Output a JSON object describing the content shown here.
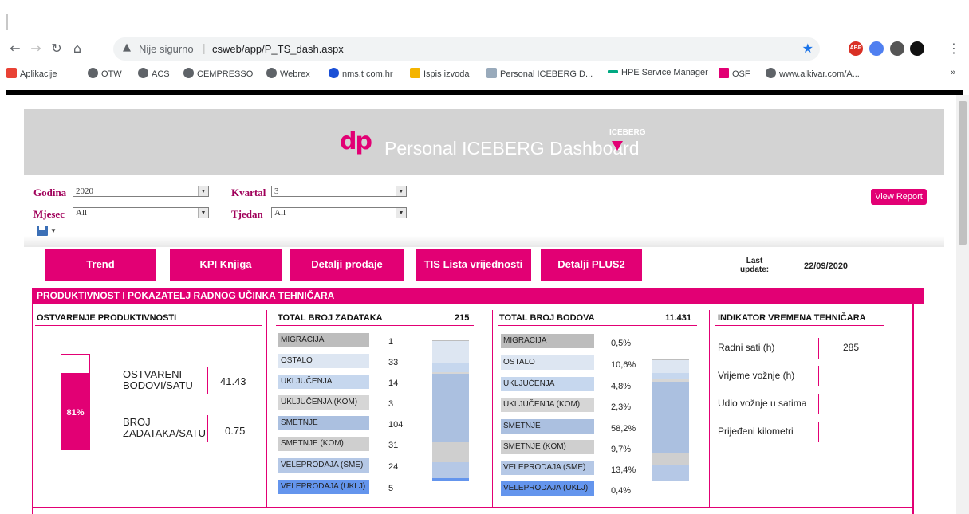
{
  "browser": {
    "url_warning": "Nije sigurno",
    "url_host": "csweb/app/P_TS_dash.aspx",
    "bookmarks": [
      "Aplikacije",
      "OTW",
      "ACS",
      "CEMPRESSO",
      "Webrex",
      "nms.t com.hr",
      "Ispis izvoda",
      "Personal ICEBERG D...",
      "HPE Service Manager",
      "OSF",
      "www.alkivar.com/A..."
    ],
    "more": "»"
  },
  "banner": {
    "logo": "dp",
    "title": "Personal ICEBERG Dashboard",
    "iceberg_logo": "ICEBERG"
  },
  "params": {
    "godina_label": "Godina",
    "godina_value": "2020",
    "kvartal_label": "Kvartal",
    "kvartal_value": "3",
    "mjesec_label": "Mjesec",
    "mjesec_value": "All",
    "tjedan_label": "Tjedan",
    "tjedan_value": "All",
    "view_report": "View Report"
  },
  "nav": [
    "Trend",
    "KPI Knjiga",
    "Detalji prodaje",
    "TIS Lista vrijednosti",
    "Detalji PLUS2"
  ],
  "last_update": {
    "label_1": "Last",
    "label_2": "update:",
    "date": "22/09/2020"
  },
  "section_title": "PRODUKTIVNOST I POKAZATELJ RADNOG UČINKA TEHNIČARA",
  "productivity": {
    "title": "OSTVARENJE PRODUKTIVNOSTI",
    "gauge_percent": 81,
    "gauge_label": "81%",
    "bodovi_label_1": "OSTVARENI",
    "bodovi_label_2": "BODOVI/SATU",
    "bodovi_value": "41.43",
    "zadaci_label_1": "BROJ",
    "zadaci_label_2": "ZADATAKA/SATU",
    "zadaci_value": "0.75"
  },
  "tasks": {
    "title": "TOTAL BROJ ZADATAKA",
    "total": "215",
    "rows": [
      {
        "label": "MIGRACIJA",
        "value": "1",
        "color": "#bdbdbd"
      },
      {
        "label": "OSTALO",
        "value": "33",
        "color": "#dde6f2"
      },
      {
        "label": "UKLJUČENJA",
        "value": "14",
        "color": "#c6d7ee"
      },
      {
        "label": "UKLJUČENJA (KOM)",
        "value": "3",
        "color": "#d6d6d6"
      },
      {
        "label": "SMETNJE",
        "value": "104",
        "color": "#abc0e0"
      },
      {
        "label": "SMETNJE (KOM)",
        "value": "31",
        "color": "#cfcfcf"
      },
      {
        "label": "VELEPRODAJA (SME)",
        "value": "24",
        "color": "#b5c8e6"
      },
      {
        "label": "VELEPRODAJA (UKLJ)",
        "value": "5",
        "color": "#6495ed"
      }
    ]
  },
  "points": {
    "title": "TOTAL BROJ BODOVA",
    "total": "11.431",
    "rows": [
      {
        "label": "MIGRACIJA",
        "value": "0,5%",
        "color": "#bdbdbd"
      },
      {
        "label": "OSTALO",
        "value": "10,6%",
        "color": "#dde6f2"
      },
      {
        "label": "UKLJUČENJA",
        "value": "4,8%",
        "color": "#c6d7ee"
      },
      {
        "label": "UKLJUČENJA (KOM)",
        "value": "2,3%",
        "color": "#d6d6d6"
      },
      {
        "label": "SMETNJE",
        "value": "58,2%",
        "color": "#abc0e0"
      },
      {
        "label": "SMETNJE (KOM)",
        "value": "9,7%",
        "color": "#cfcfcf"
      },
      {
        "label": "VELEPRODAJA (SME)",
        "value": "13,4%",
        "color": "#b5c8e6"
      },
      {
        "label": "VELEPRODAJA (UKLJ)",
        "value": "0,4%",
        "color": "#6495ed"
      }
    ]
  },
  "indicator": {
    "title": "INDIKATOR VREMENA TEHNIČARA",
    "rows": [
      {
        "label": "Radni sati (h)",
        "value": "285"
      },
      {
        "label": "Vrijeme vožnje (h)",
        "value": ""
      },
      {
        "label": "Udio vožnje u satima",
        "value": ""
      },
      {
        "label": "Prijeđeni kilometri",
        "value": ""
      }
    ]
  },
  "colors": {
    "accent": "#e20074",
    "banner_bg": "#d3d3d3"
  }
}
